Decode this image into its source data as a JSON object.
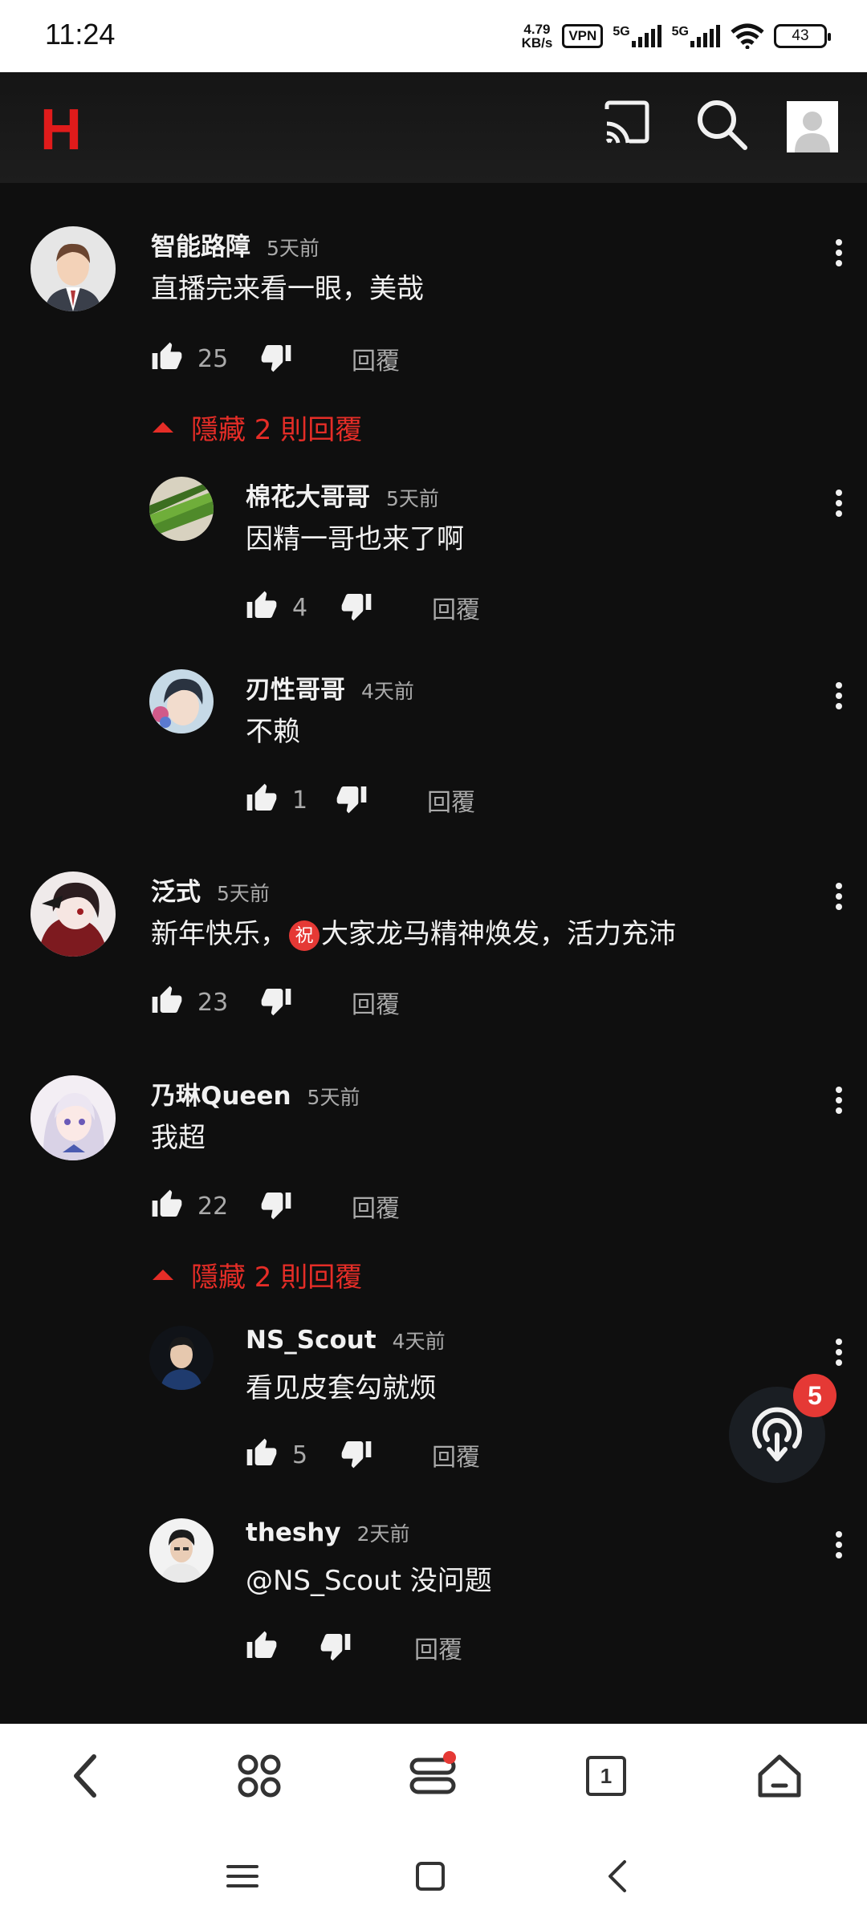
{
  "status_bar": {
    "time": "11:24",
    "speed_value": "4.79",
    "speed_unit": "KB/s",
    "vpn": "VPN",
    "net1": "5G",
    "net2": "5G",
    "battery": "43"
  },
  "header": {
    "logo": "H"
  },
  "comments": [
    {
      "author": "智能路障",
      "time": "5天前",
      "text": "直播完来看一眼，美哉",
      "likes": "25",
      "reply": "回覆",
      "hide_replies": "隱藏 2 則回覆",
      "replies": [
        {
          "author": "棉花大哥哥",
          "time": "5天前",
          "text": "因精一哥也来了啊",
          "likes": "4",
          "reply": "回覆"
        },
        {
          "author": "刃性哥哥",
          "time": "4天前",
          "text": "不赖",
          "likes": "1",
          "reply": "回覆"
        }
      ]
    },
    {
      "author": "泛式",
      "time": "5天前",
      "text_before": "新年快乐，",
      "emoji": "祝",
      "text_after": "大家龙马精神焕发，活力充沛",
      "likes": "23",
      "reply": "回覆"
    },
    {
      "author": "乃琳Queen",
      "time": "5天前",
      "text": "我超",
      "likes": "22",
      "reply": "回覆",
      "hide_replies": "隱藏 2 則回覆",
      "replies": [
        {
          "author": "NS_Scout",
          "time": "4天前",
          "text": "看见皮套勾就烦",
          "likes": "5",
          "reply": "回覆"
        },
        {
          "author": "theshy",
          "time": "2天前",
          "text": "@NS_Scout 没问题",
          "likes": "",
          "reply": "回覆"
        }
      ]
    }
  ],
  "floating_badge": "5",
  "toolbar": {
    "tab_count": "1"
  },
  "colors": {
    "background": "#0f0f0f",
    "accent_red": "#e52d27",
    "muted_text": "#aaaaaa",
    "logo_red": "#e01b1b"
  },
  "icons": [
    "cast-icon",
    "search-icon",
    "account-avatar-icon",
    "thumb-up-icon",
    "thumb-down-icon",
    "more-vert-icon",
    "live-broadcast-icon",
    "back-icon",
    "apps-icon",
    "menu-icon",
    "tabs-icon",
    "home-icon",
    "recents-icon",
    "square-icon"
  ]
}
